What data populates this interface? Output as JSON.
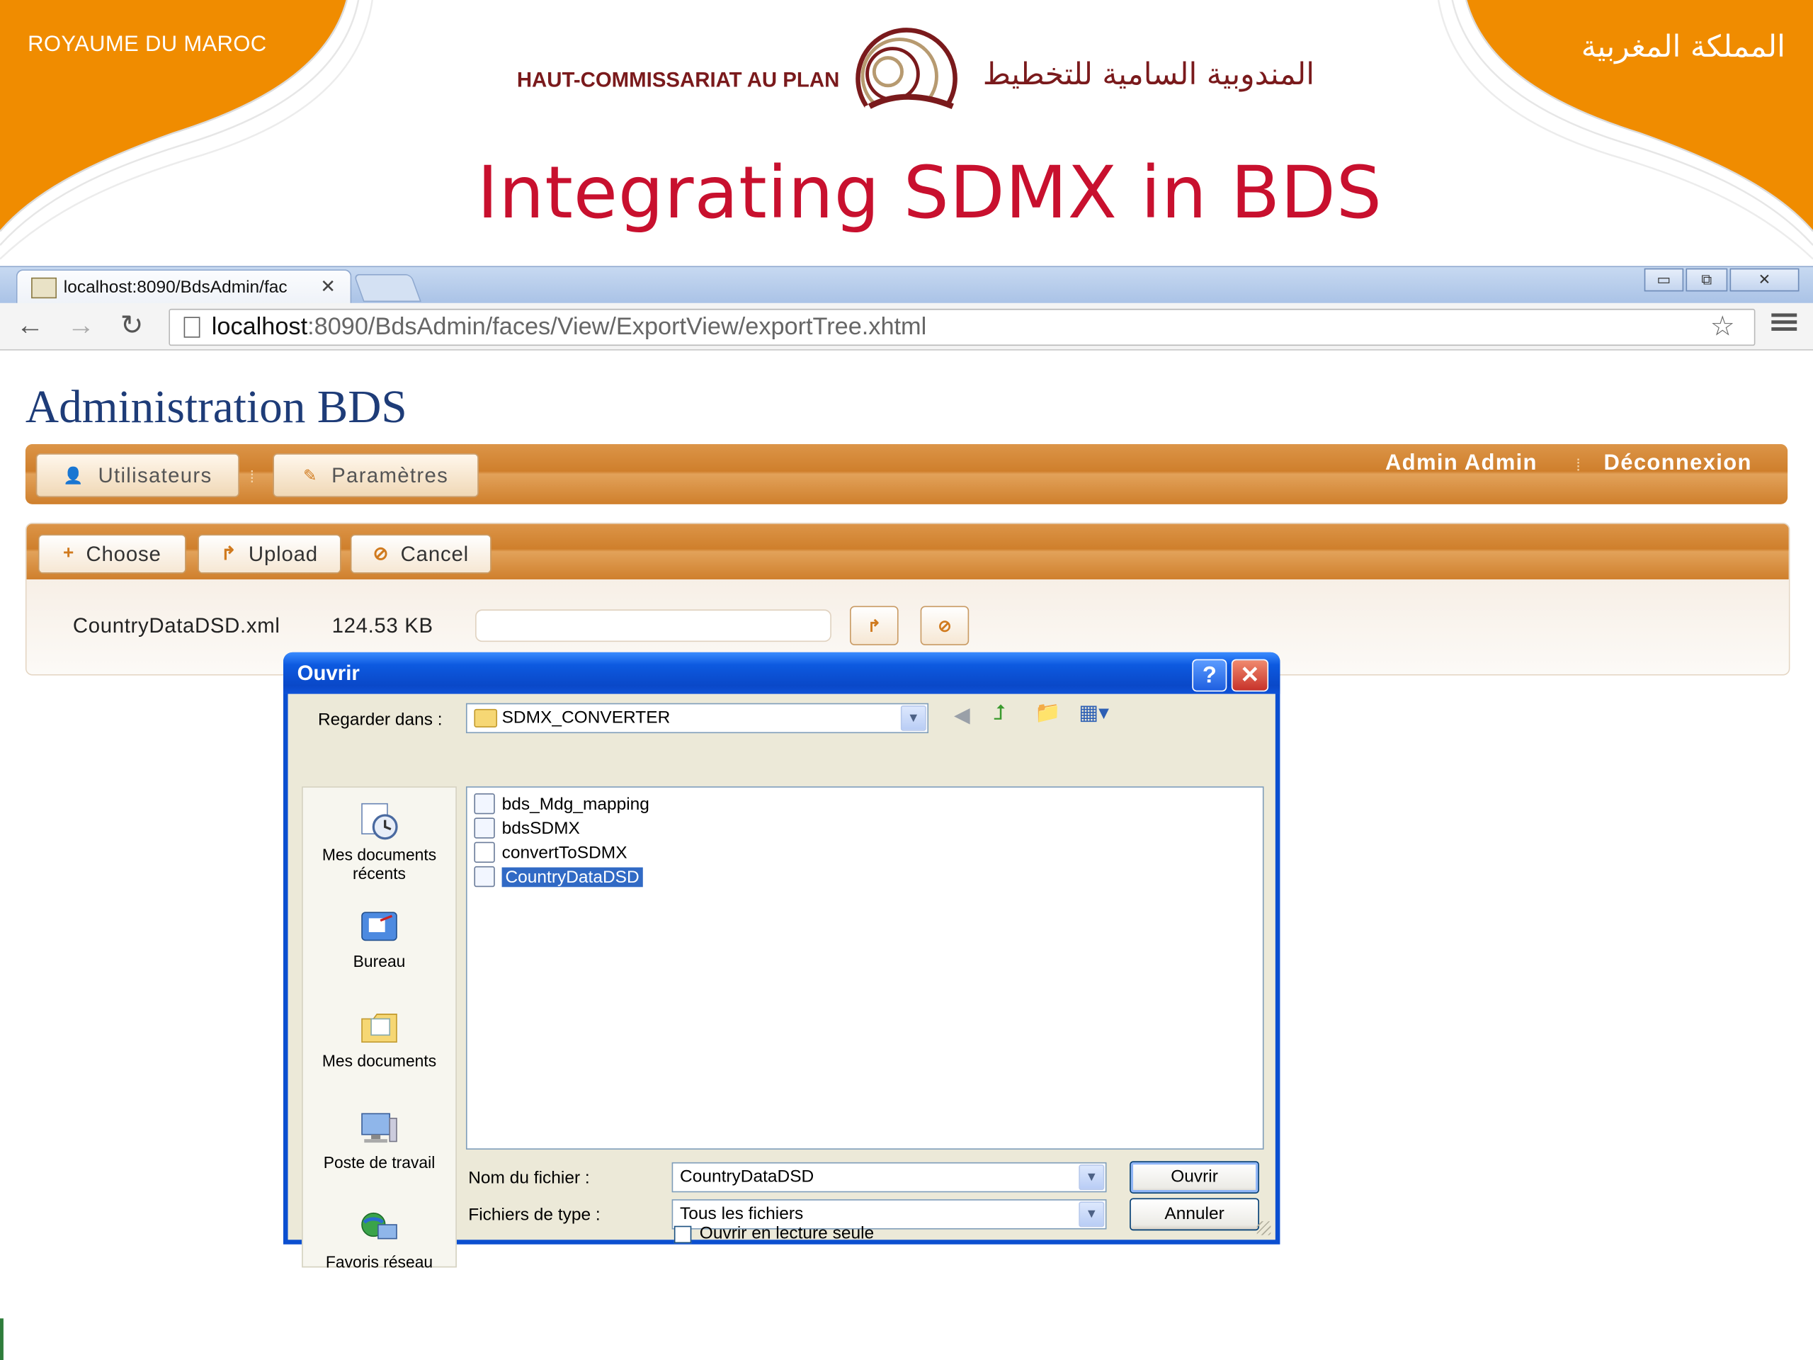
{
  "slide": {
    "kingdom_fr": "ROYAUME DU MAROC",
    "kingdom_ar": "المملكة المغربية",
    "org_fr": "HAUT-COMMISSARIAT AU PLAN",
    "org_ar": "المندوبية السامية للتخطيط",
    "title": "Integrating SDMX in BDS",
    "colors": {
      "orange": "#f08c00",
      "title_red": "#c8102e",
      "logo_maroon": "#7a1a1c"
    }
  },
  "browser": {
    "tab_title": "localhost:8090/BdsAdmin/fac",
    "url_host": "localhost",
    "url_rest": ":8090/BdsAdmin/faces/View/ExportView/exportTree.xhtml",
    "icons": [
      "back-arrow-icon",
      "forward-arrow-icon",
      "reload-icon",
      "page-icon",
      "star-icon",
      "menu-icon"
    ]
  },
  "app": {
    "title": "Administration BDS",
    "menu": [
      {
        "label": "Utilisateurs",
        "icon": "user-icon"
      },
      {
        "label": "Paramètres",
        "icon": "wrench-icon"
      }
    ],
    "user": "Admin Admin",
    "logout": "Déconnexion",
    "uploader": {
      "choose": "Choose",
      "upload": "Upload",
      "cancel": "Cancel",
      "file_name": "CountryDataDSD.xml",
      "file_size": "124.53 KB"
    },
    "colors": {
      "bar_orange": "#cf7f2c",
      "title_blue": "#1e3c78"
    }
  },
  "dialog": {
    "title": "Ouvrir",
    "look_in_label": "Regarder dans :",
    "look_in_value": "SDMX_CONVERTER",
    "places": [
      "Mes documents récents",
      "Bureau",
      "Mes documents",
      "Poste de travail",
      "Favoris réseau"
    ],
    "files": [
      {
        "name": "bds_Mdg_mapping",
        "icon": "browser-file-icon"
      },
      {
        "name": "bdsSDMX",
        "icon": "browser-file-icon"
      },
      {
        "name": "convertToSDMX",
        "icon": "window-file-icon"
      },
      {
        "name": "CountryDataDSD",
        "icon": "browser-file-icon",
        "selected": true
      }
    ],
    "filename_label": "Nom du fichier :",
    "filename_value": "CountryDataDSD",
    "filetype_label": "Fichiers de type :",
    "filetype_value": "Tous les fichiers",
    "readonly_label": "Ouvrir en lecture seule",
    "readonly_checked": false,
    "open_button": "Ouvrir",
    "cancel_button": "Annuler",
    "colors": {
      "title_blue": "#0a48c8",
      "body": "#ece9d8",
      "selection": "#316ac5"
    }
  }
}
